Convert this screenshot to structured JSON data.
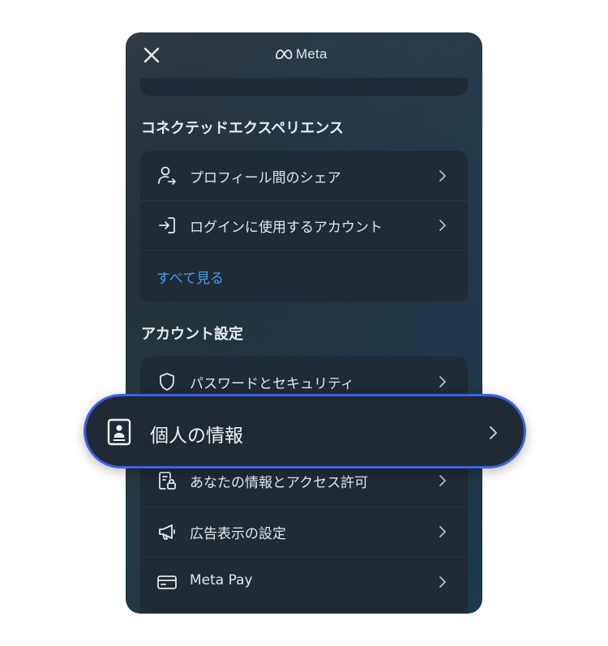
{
  "header": {
    "brand": "Meta",
    "close_icon": "close-icon",
    "brand_icon": "meta-infinity-logo"
  },
  "sections": [
    {
      "title": "コネクテッドエクスペリエンス",
      "items": [
        {
          "label": "プロフィール間のシェア",
          "icon": "person-share-icon"
        },
        {
          "label": "ログインに使用するアカウント",
          "icon": "login-arrow-icon"
        }
      ],
      "see_all": "すべて見る"
    },
    {
      "title": "アカウント設定",
      "items": [
        {
          "label": "パスワードとセキュリティ",
          "icon": "shield-icon"
        },
        {
          "label": "あなたの情報とアクセス許可",
          "icon": "document-lock-icon"
        },
        {
          "label": "広告表示の設定",
          "icon": "megaphone-icon"
        },
        {
          "label": "Meta Pay",
          "icon": "card-icon"
        }
      ]
    }
  ],
  "highlight": {
    "label": "個人の情報",
    "icon": "id-badge-icon"
  },
  "colors": {
    "accent_link": "#4a9ae6",
    "highlight_border": "#3f63e6",
    "card_bg": "#1f2b35",
    "text": "#e3e8eb"
  }
}
